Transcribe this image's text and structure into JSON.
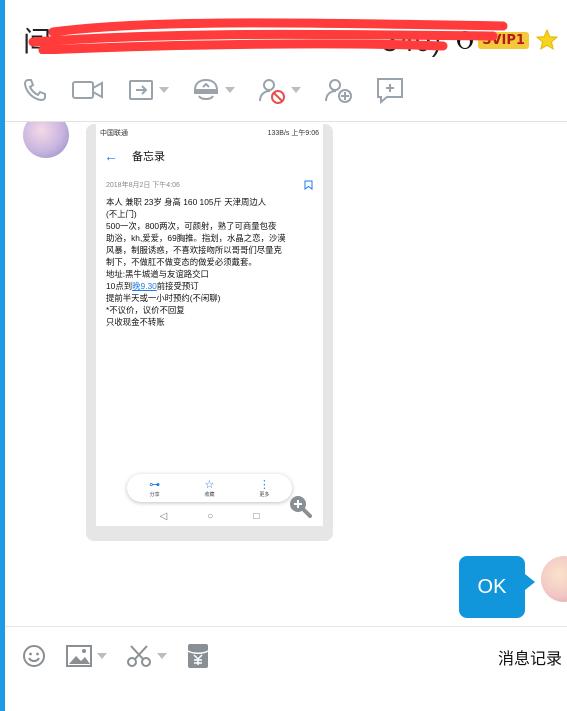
{
  "window": {
    "title_visible_tail": "340)",
    "title_prefix": "间",
    "vip_label": "SVIP1",
    "accent_color": "#1e9be6"
  },
  "toolbar": {
    "items": [
      {
        "icon": "phone-icon"
      },
      {
        "icon": "video-icon"
      },
      {
        "icon": "share-screen-icon"
      },
      {
        "icon": "remote-assist-icon"
      },
      {
        "icon": "block-user-icon"
      },
      {
        "icon": "add-friend-icon"
      },
      {
        "icon": "new-message-icon"
      }
    ]
  },
  "shared_image": {
    "status_left": "中国联通",
    "status_right": "133B/s  上午9:06",
    "app_title": "备忘录",
    "note_date": "2018年8月2日 下午4:06",
    "lines": [
      "本人  兼职   23岁 身高 160    105斤  天津周边人",
      "(不上门)",
      "500一次，800两次，可颜射，熟了可商量包夜",
      "助浴，kh,爱爱，69胸推。指划，水晶之恋，沙漠",
      "风暴，制服诱惑，不喜欢接吻所以哥哥们尽量克",
      "制下，不做肛不做变态的做爱必须戴套。",
      "地址:黑牛城道与友谊路交口"
    ],
    "time_line_prefix": "10点到",
    "time_link": "晚9.30",
    "time_line_suffix": "前接受预订",
    "lines2": [
      "提前半天或一小时预约(不闲聊)",
      "*不议价，议价不回复",
      "只收现金不转账"
    ],
    "pill": {
      "share": "分享",
      "favorite": "收藏",
      "more": "更多"
    }
  },
  "reply": {
    "text": "OK"
  },
  "input_toolbar": {
    "history_label": "消息记录"
  }
}
